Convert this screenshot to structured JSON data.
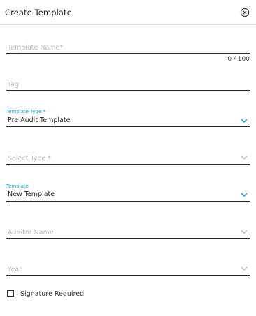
{
  "dialog": {
    "title": "Create Template",
    "close_icon": "close-circle-icon"
  },
  "fields": {
    "template_name": {
      "placeholder": "Template Name*",
      "value": "",
      "counter": "0 / 100"
    },
    "tag": {
      "placeholder": "Tag",
      "value": ""
    },
    "template_type": {
      "label": "Template Type *",
      "value": "Pre Audit Template"
    },
    "select_type": {
      "placeholder": "Select Type *",
      "value": ""
    },
    "template": {
      "label": "Template",
      "value": "New Template"
    },
    "auditor_name": {
      "placeholder": "Auditor Name",
      "value": ""
    },
    "year": {
      "placeholder": "Year",
      "value": ""
    }
  },
  "signature": {
    "label": "Signature Required",
    "checked": false
  },
  "colors": {
    "accent": "#1aa0c9",
    "underline": "#2b2b2b",
    "placeholder": "#b9b9b9",
    "text": "#222222"
  }
}
